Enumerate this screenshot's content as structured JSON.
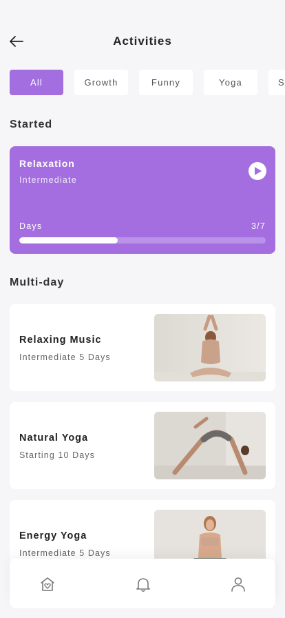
{
  "header": {
    "title": "Activities"
  },
  "chips": [
    {
      "label": "All",
      "active": true
    },
    {
      "label": "Growth",
      "active": false
    },
    {
      "label": "Funny",
      "active": false
    },
    {
      "label": "Yoga",
      "active": false
    },
    {
      "label": "Sc",
      "active": false
    }
  ],
  "started": {
    "section_title": "Started",
    "card": {
      "name": "Relaxation",
      "level": "Intermediate",
      "days_label": "Days",
      "days_count": "3/7",
      "progress": 0.4
    }
  },
  "multiday": {
    "section_title": "Multi-day",
    "items": [
      {
        "name": "Relaxing Music",
        "subtitle": "Intermediate 5 Days"
      },
      {
        "name": "Natural Yoga",
        "subtitle": "Starting 10 Days"
      },
      {
        "name": "Energy Yoga",
        "subtitle": "Intermediate 5 Days"
      }
    ]
  },
  "icons": {
    "back": "arrow-left-icon",
    "play": "play-icon",
    "home": "home-heart-icon",
    "notifications": "bell-icon",
    "profile": "user-icon"
  },
  "colors": {
    "accent": "#a56ee0",
    "background": "#f6f6f8"
  }
}
